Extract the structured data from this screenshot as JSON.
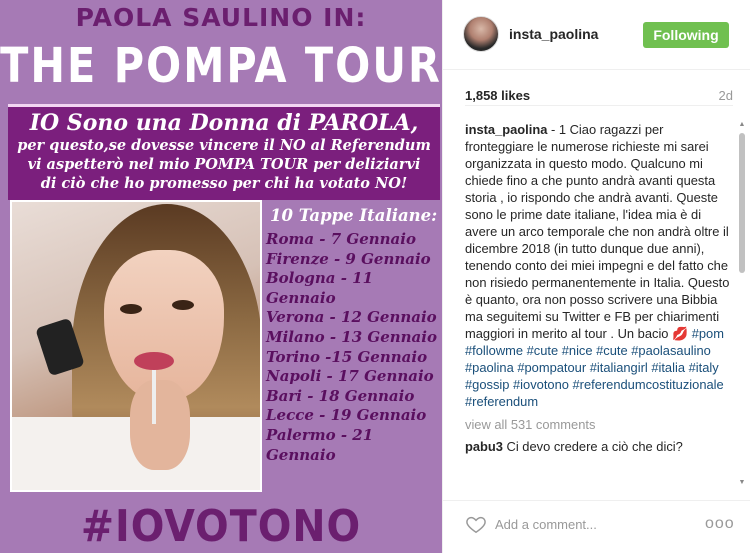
{
  "post_image": {
    "header_line1": "PAOLA SAULINO IN:",
    "header_line2": "THE POMPA TOUR",
    "banner_big": "IO Sono una Donna di PAROLA,",
    "banner_lines": [
      "per questo,se dovesse vincere il NO al Referendum",
      "vi aspetterò nel mio POMPA TOUR per deliziarvi",
      "di ciò che ho promesso per chi ha votato NO!"
    ],
    "dates_title": "10 Tappe Italiane:",
    "dates": [
      "Roma - 7 Gennaio",
      "Firenze - 9 Gennaio",
      "Bologna - 11 Gennaio",
      "Verona - 12 Gennaio",
      "Milano - 13 Gennaio",
      "Torino -15 Gennaio",
      "Napoli - 17 Gennaio",
      "Bari  -  18 Gennaio",
      "Lecce - 19 Gennaio",
      "Palermo - 21 Gennaio"
    ],
    "hashtag": "#IOVOTONO"
  },
  "header": {
    "username": "insta_paolina",
    "follow_label": "Following"
  },
  "stats": {
    "likes": "1,858 likes",
    "age": "2d"
  },
  "caption": {
    "username": "insta_paolina",
    "text": " - 1 Ciao ragazzi per fronteggiare le numerose richieste mi sarei organizzata in questo modo. Qualcuno mi chiede fino a che punto andrà avanti questa storia , io rispondo che andrà avanti. Queste sono le prime date italiane, l'idea mia è di avere un arco temporale che non andrà oltre il dicembre 2018 (in tutto dunque due anni), tenendo conto dei miei impegni e del fatto che non risiedo permanentemente in Italia. Questo è quanto, ora non posso scrivere una Bibbia ma seguitemi su Twitter e FB per chiarimenti maggiori in merito al tour . Un bacio 💋 ",
    "tags": "#pom #followme #cute #nice #cute #paolasaulino #paolina #pompatour #italiangirl #italia #italy #gossip #iovotono #referendumcostituzionale #referendum"
  },
  "view_all": "view all 531 comments",
  "comment2": {
    "username": "pabu3",
    "text": " Ci devo credere a ciò che dici?"
  },
  "footer": {
    "comment_placeholder": "Add a comment...",
    "more_label": "ooo"
  }
}
